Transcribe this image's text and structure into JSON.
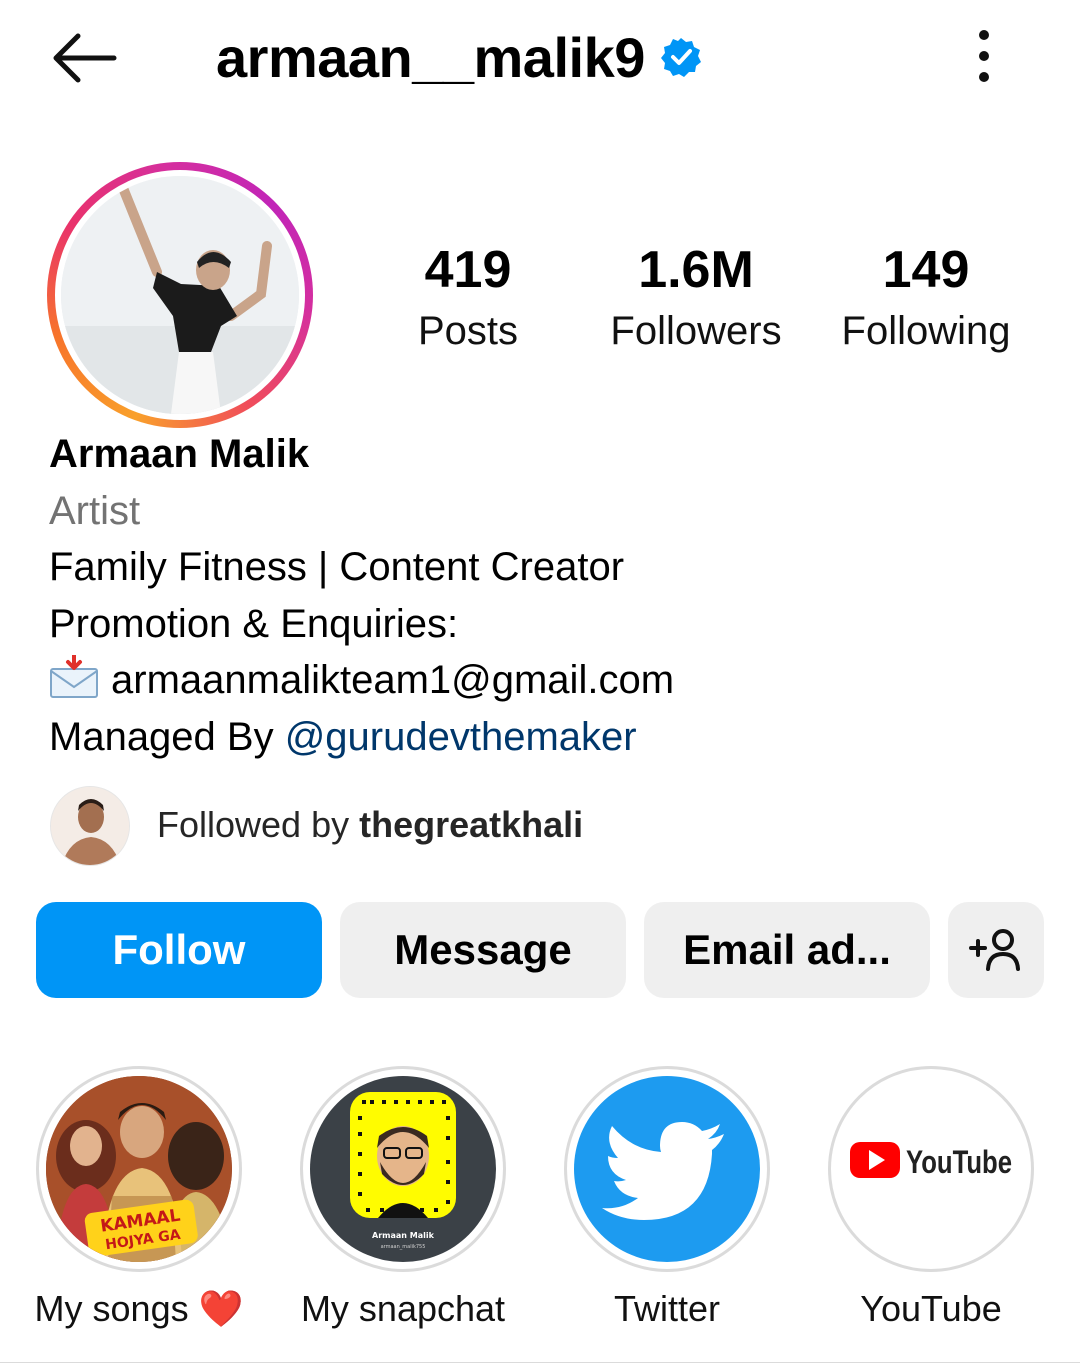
{
  "header": {
    "username": "armaan__malik9",
    "back_icon": "arrow-left-icon",
    "verified_icon": "verified-badge-icon",
    "menu_icon": "more-vertical-icon"
  },
  "stats": [
    {
      "value": "419",
      "label": "Posts"
    },
    {
      "value": "1.6M",
      "label": "Followers"
    },
    {
      "value": "149",
      "label": "Following"
    }
  ],
  "bio": {
    "name": "Armaan Malik",
    "category": "Artist",
    "line1": "Family Fitness | Content Creator",
    "line2": "Promotion & Enquiries:",
    "email": "armaanmalikteam1@gmail.com",
    "managed_prefix": "Managed By ",
    "managed_mention": "@gurudevthemaker"
  },
  "followed_by": {
    "prefix": "Followed by ",
    "user": "thegreatkhali"
  },
  "buttons": {
    "follow": "Follow",
    "message": "Message",
    "email": "Email ad...",
    "add_user_icon": "person-add-icon"
  },
  "highlights": [
    {
      "label": "My songs ❤️",
      "thumb_text": "KAMAAL HOJYA GA"
    },
    {
      "label": "My snapchat",
      "thumb_text": "Armaan Malik",
      "thumb_subtext": "armaan_malik755"
    },
    {
      "label": "Twitter"
    },
    {
      "label": "YouTube",
      "thumb_text": "YouTube"
    }
  ],
  "colors": {
    "follow_blue": "#0095f6",
    "verified_blue": "#0095f6",
    "mention": "#00376b",
    "snap_yellow": "#fffc00",
    "twitter_blue": "#1d9bf0",
    "youtube_red": "#ff0000"
  }
}
